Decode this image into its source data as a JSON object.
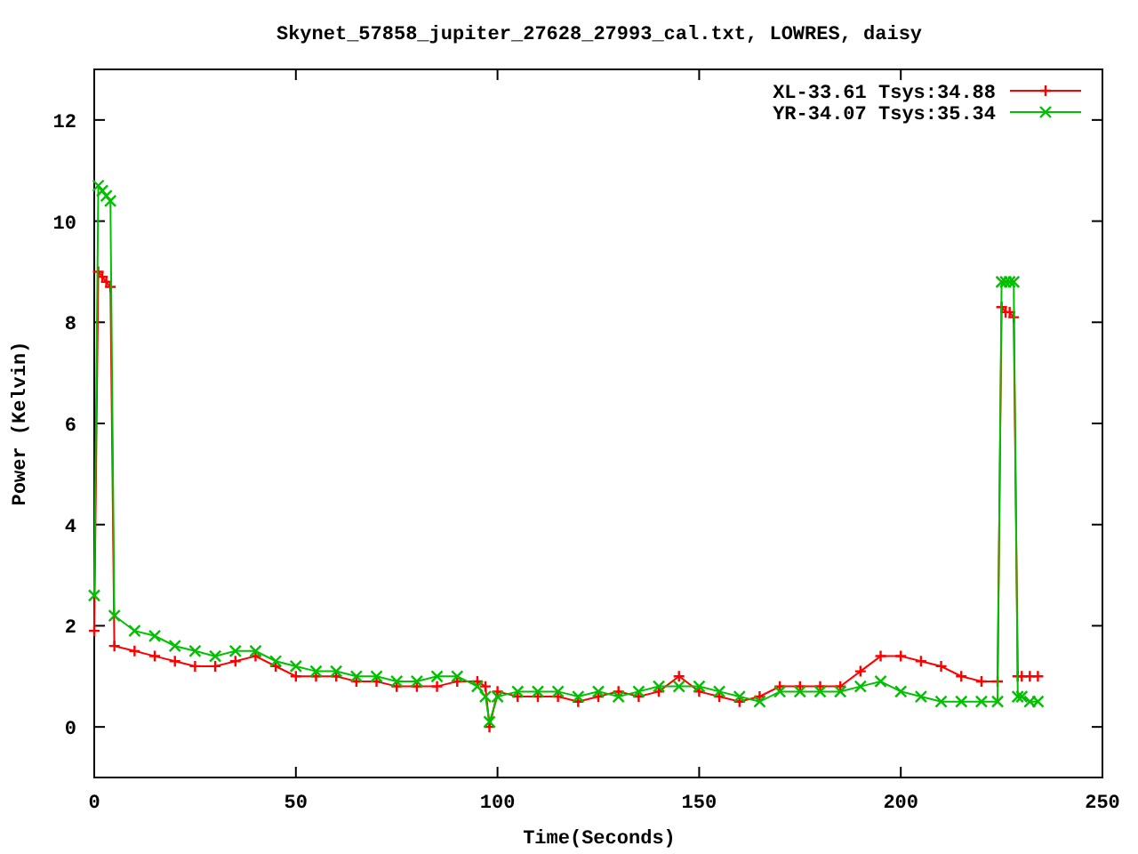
{
  "plot": {
    "chart_data": {
      "type": "line",
      "title": "Skynet_57858_jupiter_27628_27993_cal.txt, LOWRES, daisy",
      "xlabel": "Time(Seconds)",
      "ylabel": "Power (Kelvin)",
      "x": [
        0,
        1,
        2,
        3,
        4,
        5,
        10,
        15,
        20,
        25,
        30,
        35,
        40,
        45,
        50,
        55,
        60,
        65,
        70,
        75,
        80,
        85,
        90,
        95,
        97,
        98,
        100,
        105,
        110,
        115,
        120,
        125,
        130,
        135,
        140,
        145,
        150,
        155,
        160,
        165,
        170,
        175,
        180,
        185,
        190,
        195,
        200,
        205,
        210,
        215,
        220,
        224,
        225,
        226,
        227,
        228,
        229,
        230,
        232,
        234
      ],
      "series": [
        {
          "name": "XL-33.61 Tsys:34.88",
          "color": "#ff0000",
          "marker": "plus",
          "values": [
            1.9,
            9.0,
            8.9,
            8.8,
            8.7,
            1.6,
            1.5,
            1.4,
            1.3,
            1.2,
            1.2,
            1.3,
            1.4,
            1.2,
            1.0,
            1.0,
            1.0,
            0.9,
            0.9,
            0.8,
            0.8,
            0.8,
            0.9,
            0.9,
            0.8,
            0.0,
            0.7,
            0.6,
            0.6,
            0.6,
            0.5,
            0.6,
            0.7,
            0.6,
            0.7,
            1.0,
            0.7,
            0.6,
            0.5,
            0.6,
            0.8,
            0.8,
            0.8,
            0.8,
            1.1,
            1.4,
            1.4,
            1.3,
            1.2,
            1.0,
            0.9,
            0.9,
            8.3,
            8.2,
            8.2,
            8.1,
            1.0,
            1.0,
            1.0,
            1.0
          ]
        },
        {
          "name": "YR-34.07 Tsys:35.34",
          "color": "#00c000",
          "marker": "x",
          "values": [
            2.6,
            10.7,
            10.6,
            10.5,
            10.4,
            2.2,
            1.9,
            1.8,
            1.6,
            1.5,
            1.4,
            1.5,
            1.5,
            1.3,
            1.2,
            1.1,
            1.1,
            1.0,
            1.0,
            0.9,
            0.9,
            1.0,
            1.0,
            0.8,
            0.6,
            0.1,
            0.6,
            0.7,
            0.7,
            0.7,
            0.6,
            0.7,
            0.6,
            0.7,
            0.8,
            0.8,
            0.8,
            0.7,
            0.6,
            0.5,
            0.7,
            0.7,
            0.7,
            0.7,
            0.8,
            0.9,
            0.7,
            0.6,
            0.5,
            0.5,
            0.5,
            0.5,
            8.8,
            8.8,
            8.8,
            8.8,
            0.6,
            0.6,
            0.5,
            0.5
          ]
        }
      ],
      "legend": true,
      "xlim": [
        0,
        250
      ],
      "ylim": [
        -1,
        13
      ],
      "xticks": [
        0,
        50,
        100,
        150,
        200,
        250
      ],
      "yticks": [
        0,
        2,
        4,
        6,
        8,
        10,
        12
      ]
    }
  }
}
